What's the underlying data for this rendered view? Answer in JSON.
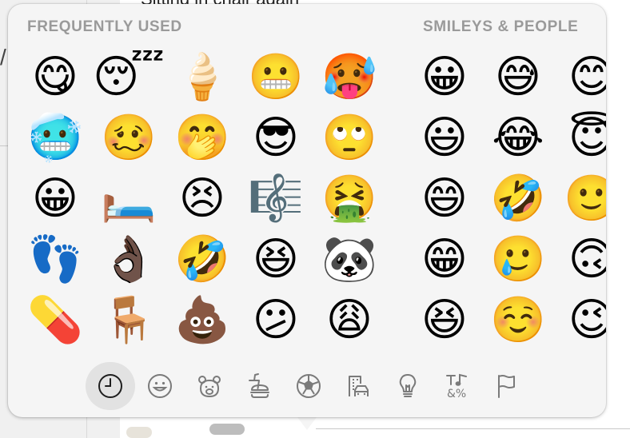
{
  "background": {
    "text": "Sitting in chair again",
    "slash": "/"
  },
  "emoji_picker": {
    "sections": {
      "frequently_used": {
        "title": "FREQUENTLY USED",
        "emojis": [
          "😋",
          "😴",
          "🍦",
          "😬",
          "🥵",
          "🥶",
          "🥴",
          "🤭",
          "😎",
          "🙄",
          "😀",
          "🛏️",
          "😣",
          "🎼",
          "🤮",
          "👣",
          "👌🏿",
          "🤣",
          "😆",
          "🐼",
          "💊",
          "🪑",
          "💩",
          "😕",
          "😩"
        ]
      },
      "smileys_people": {
        "title": "SMILEYS & PEOPLE",
        "emojis": [
          "😀",
          "😅",
          "😊",
          "😃",
          "😂",
          "😇",
          "😄",
          "🤣",
          "🙂",
          "😁",
          "🥲",
          "🙃",
          "😆",
          "☺️",
          "😉"
        ]
      }
    },
    "tabs": [
      {
        "name": "frequently-used",
        "icon": "clock-icon",
        "selected": true
      },
      {
        "name": "smileys-people",
        "icon": "smiley-icon",
        "selected": false
      },
      {
        "name": "animals-nature",
        "icon": "bear-icon",
        "selected": false
      },
      {
        "name": "food-drink",
        "icon": "burger-drink-icon",
        "selected": false
      },
      {
        "name": "activity",
        "icon": "soccer-ball-icon",
        "selected": false
      },
      {
        "name": "travel-places",
        "icon": "building-car-icon",
        "selected": false
      },
      {
        "name": "objects",
        "icon": "lightbulb-icon",
        "selected": false
      },
      {
        "name": "symbols",
        "icon": "symbols-icon",
        "selected": false
      },
      {
        "name": "flags",
        "icon": "flag-icon",
        "selected": false
      }
    ],
    "colors": {
      "panel": "#f5f5f5",
      "header_text": "#9a9a9a",
      "icon_stroke": "#7a7a7a",
      "selected_tab": "#e2e2e2"
    }
  }
}
